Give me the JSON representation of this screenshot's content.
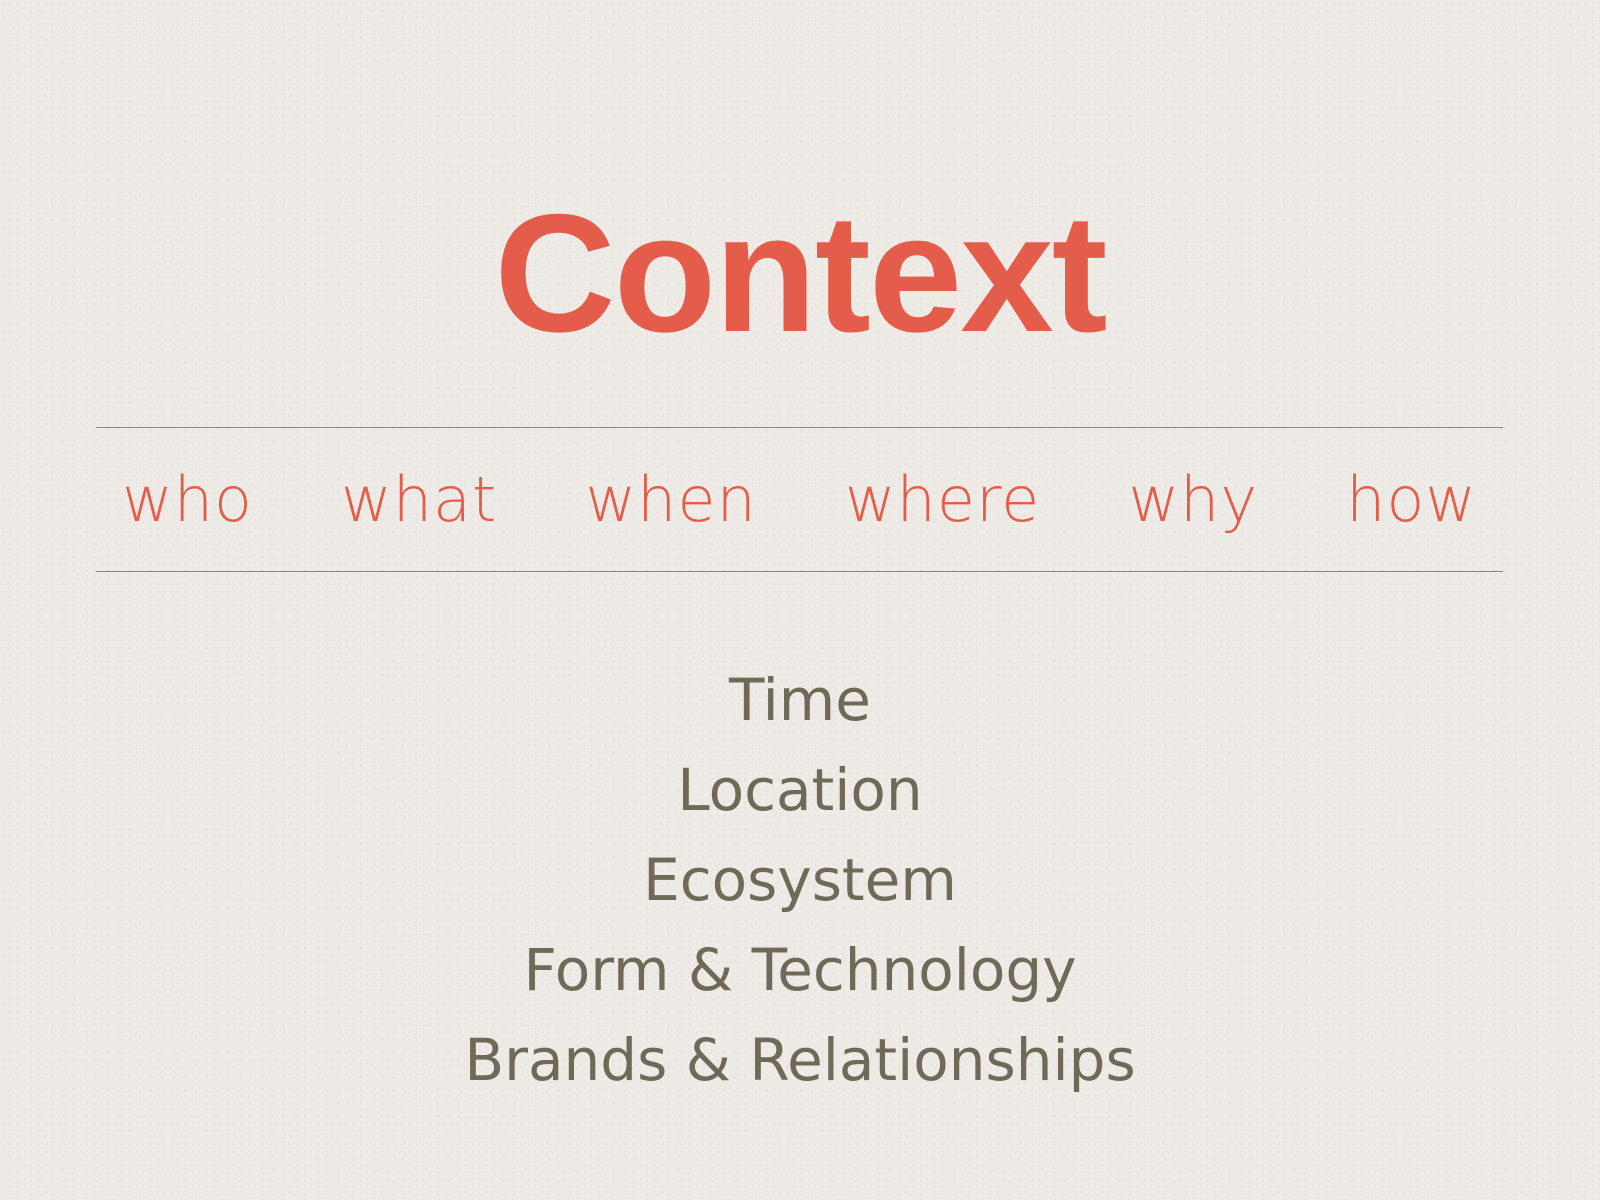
{
  "slide": {
    "title": "Context",
    "questions": [
      "who",
      "what",
      "when",
      "where",
      "why",
      "how"
    ],
    "items": [
      "Time",
      "Location",
      "Ecosystem",
      "Form & Technology",
      "Brands & Relationships"
    ],
    "colors": {
      "accent": "#e45c4a",
      "body_text": "#6f6a57",
      "rule": "#8d8a79",
      "background": "#eeebe6"
    }
  }
}
